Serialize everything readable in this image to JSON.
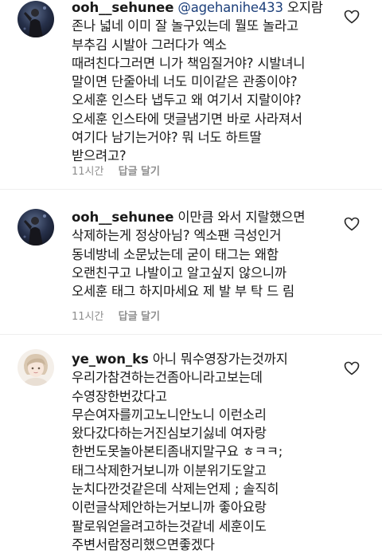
{
  "comments": [
    {
      "username": "ooh__sehunee",
      "mention": "@agehanihe433",
      "first_text": "오지람",
      "lines": [
        "존나 넓네 이미 잘 놀구있는데 뭘또 놀라고",
        "부추김 시발아 그러다가 엑소",
        "때려친다그러면 니가 책임질거야? 시발녀니",
        "말이면 단줄아네 너도 미이같은 관종이야?",
        "오세훈 인스타 냅두고 왜 여기서 지랄이야?",
        "오세훈 인스타에 댓글냄기면 바로 사라져서",
        "여기다 남기는거야? 뭐 너도 하트딸",
        "받으려고?"
      ],
      "time": "11시간",
      "reply_label": "답글 달기",
      "avatar_icon": "profile-photo-dark-performer",
      "heart_icon": "heart-outline-icon"
    },
    {
      "username": "ooh__sehunee",
      "first_text": "이만큼 와서 지랄했으면",
      "lines": [
        "삭제하는게 정상아님? 엑소팬 극성인거",
        "동네방네 소문났는데 굳이 태그는 왜함",
        "오랜친구고 나발이고 알고싶지 않으니까",
        "오세훈 태그 하지마세요 제 발 부 탁 드 림"
      ],
      "time": "11시간",
      "reply_label": "답글 달기",
      "avatar_icon": "profile-photo-dark-performer",
      "heart_icon": "heart-outline-icon"
    },
    {
      "username": "ye_won_ks",
      "first_text": "아니 뭐수영장가는것까지",
      "lines": [
        "우리가참견하는건좀아니라고보는데",
        "수영장한번갔다고",
        "무슨여자를끼고노니안노니 이런소리",
        "왔다갔다하는거진심보기싫네 여자랑",
        "한번도못놀아본티좀내지말구요 ㅎㅋㅋ;",
        "태그삭제한거보니까 이분위기도알고",
        "눈치다깐것같은데 삭제는언제 ; 솔직히",
        "이런글삭제안하는거보니까 좋아요랑",
        "팔로워얻을려고하는것같네 세훈이도",
        "주변서람정리했으면좋겠다"
      ],
      "avatar_icon": "profile-photo-light-illustration",
      "heart_icon": "heart-outline-icon"
    }
  ],
  "colors": {
    "text": "#1a1a1a",
    "meta": "#8e8e8e",
    "mention": "#1c3f7a"
  }
}
